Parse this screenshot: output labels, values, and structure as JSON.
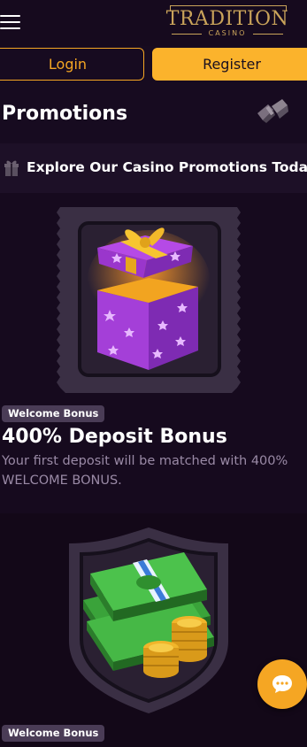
{
  "header": {
    "logo_text": "TRADITION",
    "logo_subtext": "CASINO"
  },
  "auth": {
    "login_label": "Login",
    "register_label": "Register"
  },
  "page": {
    "title": "Promotions"
  },
  "banner": {
    "text": "Explore Our Casino Promotions Today!"
  },
  "promotions": [
    {
      "badge": "Welcome Bonus",
      "title": "400% Deposit Bonus",
      "description": "Your first deposit will be matched with 400% WELCOME BONUS.",
      "image_icon": "gift-box-icon"
    },
    {
      "badge": "Welcome Bonus",
      "title": "",
      "description": "",
      "image_icon": "money-stack-icon"
    }
  ],
  "colors": {
    "accent": "#fbb32c",
    "accent_outline": "#f5a623",
    "background": "#170b20",
    "badge_bg": "#4a3c56",
    "muted_text": "#9a8aa6",
    "logo_gold": "#c9a35a"
  }
}
